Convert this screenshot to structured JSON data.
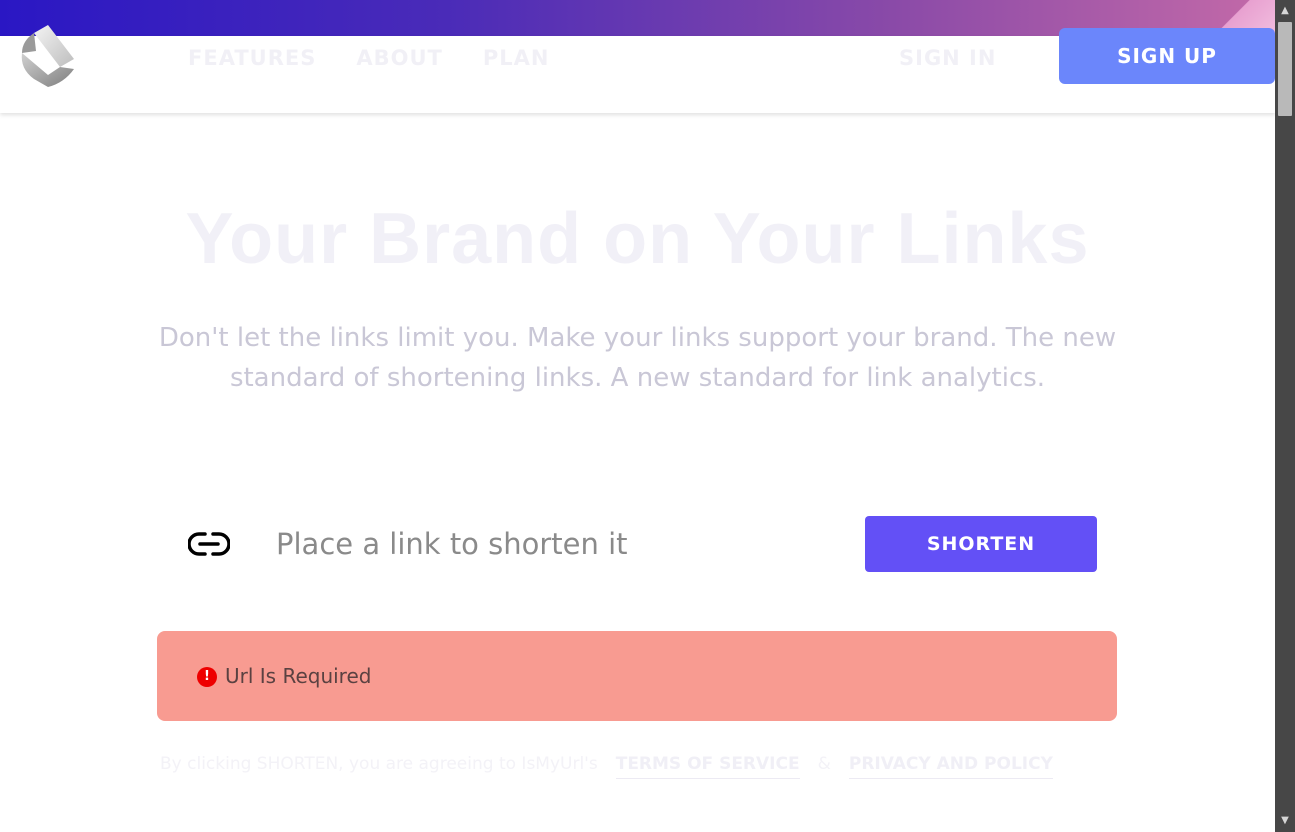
{
  "header": {
    "nav": [
      {
        "label": "FEATURES"
      },
      {
        "label": "ABOUT"
      },
      {
        "label": "PLAN"
      }
    ],
    "sign_in_label": "SIGN IN",
    "sign_up_label": "SIGN UP",
    "logo_icon": "logo-icon"
  },
  "hero": {
    "title": "Your Brand on Your Links",
    "subtitle": "Don't let the links limit you. Make your links support your brand. The new standard of shortening links. A new standard for link analytics."
  },
  "shorten": {
    "link_icon": "link-icon",
    "placeholder": "Place a link to shorten it",
    "value": "",
    "button_label": "SHORTEN"
  },
  "error": {
    "icon": "error-icon",
    "icon_glyph": "!",
    "message": "Url Is Required"
  },
  "terms": {
    "lead": "By clicking SHORTEN, you are agreeing to IsMyUrl's",
    "terms_link": "TERMS OF SERVICE",
    "amp": "&",
    "privacy_link": "PRIVACY AND POLICY"
  },
  "colors": {
    "accent": "#6350f6",
    "sign_up": "#6b86fb",
    "error_bg": "#f89b91",
    "error_icon": "#ee0000"
  }
}
